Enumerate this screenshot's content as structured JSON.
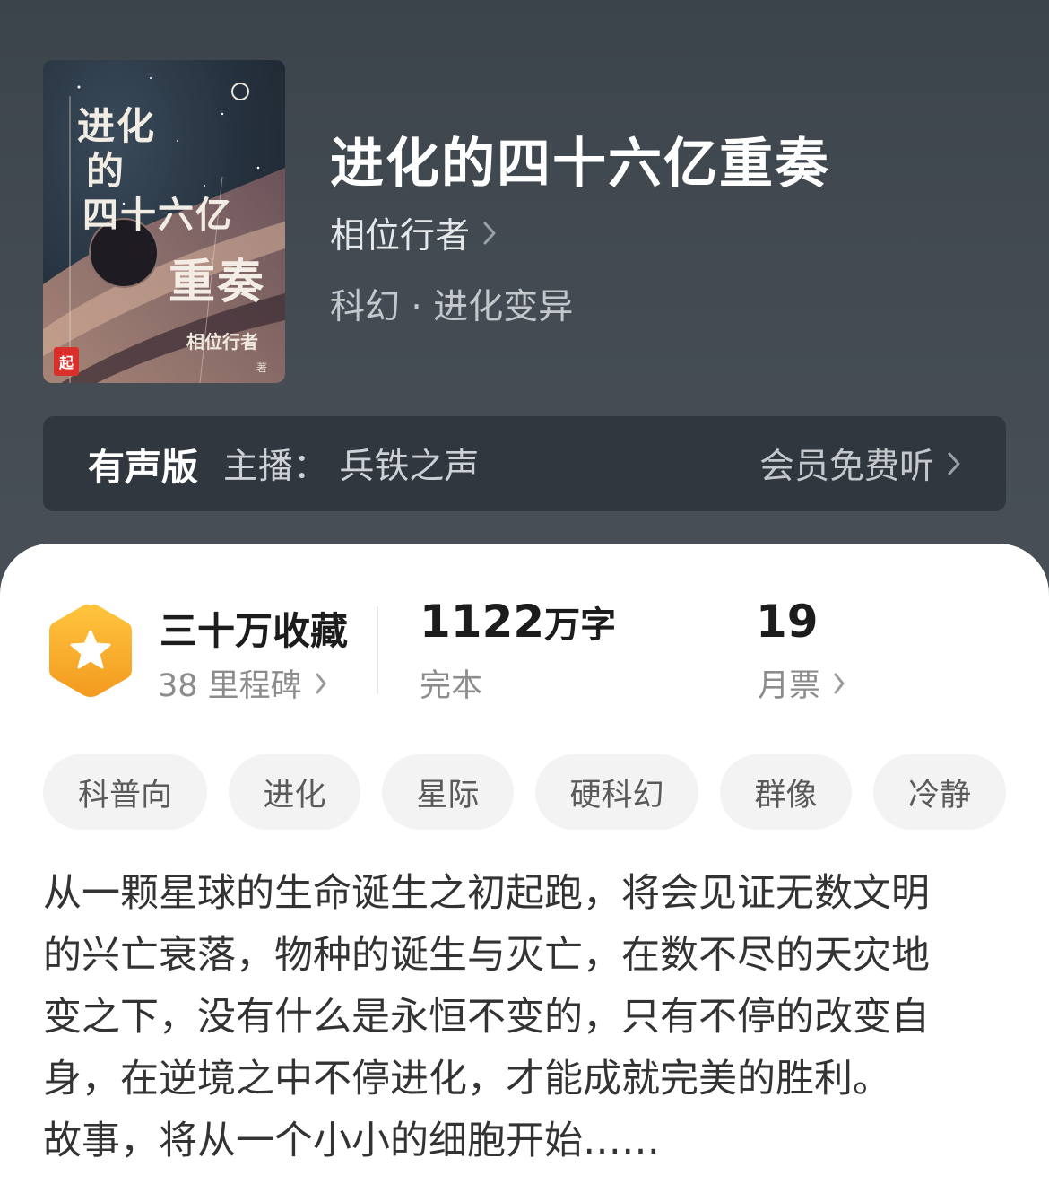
{
  "book": {
    "title": "进化的四十六亿重奏",
    "author": "相位行者",
    "genre": "科幻 · 进化变异"
  },
  "cover": {
    "title_lines": [
      "进化",
      "的",
      "四十六亿",
      "重奏"
    ],
    "author": "相位行者",
    "author_suffix": "著",
    "publisher_logo": "起"
  },
  "audio": {
    "label": "有声版",
    "host": "主播：  兵铁之声",
    "action": "会员免费听"
  },
  "stats": {
    "favorites": {
      "main": "三十万收藏",
      "sub": "38 里程碑"
    },
    "words": {
      "number": "1122",
      "unit": "万字",
      "sub": "完本"
    },
    "votes": {
      "number": "19",
      "sub": "月票"
    }
  },
  "tags": [
    "科普向",
    "进化",
    "星际",
    "硬科幻",
    "群像",
    "冷静"
  ],
  "description": {
    "lines": [
      "从一颗星球的生命诞生之初起跑，将会见证无数文明",
      "的兴亡衰落，物种的诞生与灭亡，在数不尽的天灾地",
      "变之下，没有什么是永恒不变的，只有不停的改变自",
      "身，在逆境之中不停进化，才能成就完美的胜利。",
      "故事，将从一个小小的细胞开始……"
    ]
  },
  "colors": {
    "header_bg": "#434a52",
    "badge_orange": "#f5a623",
    "tag_bg": "#f3f3f3"
  },
  "icons": [
    "chevron-right-icon",
    "star-badge-icon",
    "publisher-logo-icon"
  ]
}
